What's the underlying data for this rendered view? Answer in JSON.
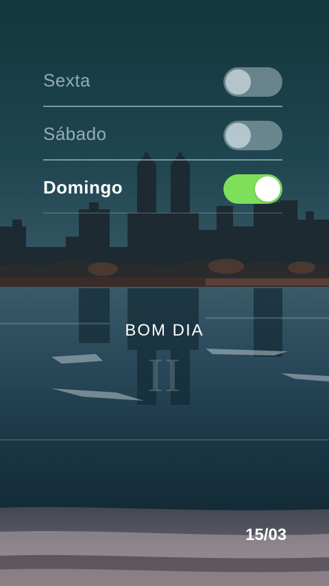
{
  "days": [
    {
      "label": "Sexta",
      "enabled": false
    },
    {
      "label": "Sábado",
      "enabled": false
    },
    {
      "label": "Domingo",
      "enabled": true
    }
  ],
  "greeting": "BOM DIA",
  "numeral": "II",
  "date": "15/03",
  "colors": {
    "toggle_on": "#7ee05a",
    "sky_top": "#15393f",
    "water": "#243f4c"
  }
}
